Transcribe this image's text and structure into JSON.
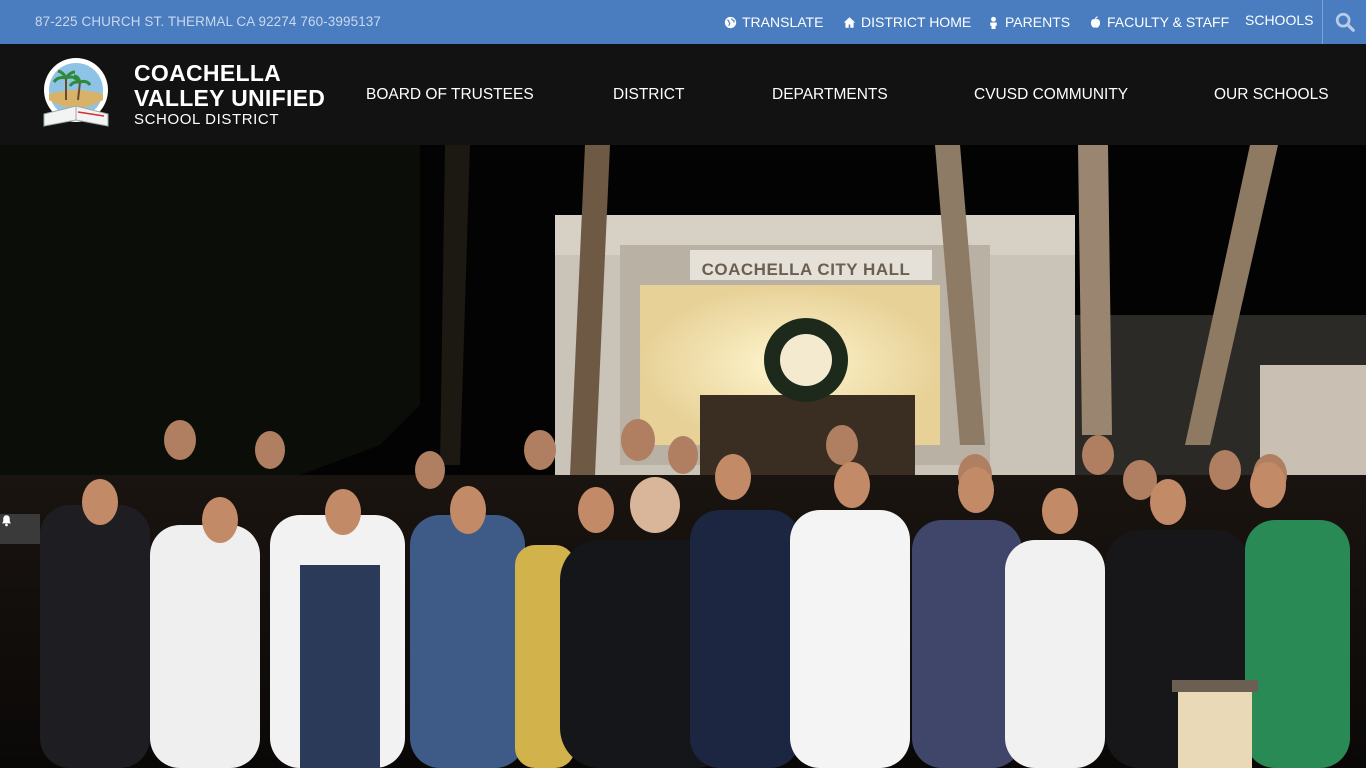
{
  "utility": {
    "address": "87-225 CHURCH ST. THERMAL CA 92274 760-3995137",
    "links": [
      {
        "label": "TRANSLATE",
        "icon": "globe-icon"
      },
      {
        "label": "DISTRICT HOME",
        "icon": "home-icon"
      },
      {
        "label": "PARENTS",
        "icon": "person-icon"
      },
      {
        "label": "FACULTY & STAFF",
        "icon": "apple-icon"
      },
      {
        "label": "SCHOOLS",
        "icon": ""
      }
    ],
    "search_icon": "search-icon",
    "bar_color": "#4a7cc0"
  },
  "brand": {
    "line1": "COACHELLA",
    "line2": "VALLEY UNIFIED",
    "line3": "SCHOOL DISTRICT"
  },
  "nav": {
    "items": [
      "BOARD OF TRUSTEES",
      "DISTRICT",
      "DEPARTMENTS",
      "CVUSD COMMUNITY",
      "OUR SCHOOLS"
    ],
    "bar_color": "#121212"
  },
  "hero": {
    "sign_text": "COACHELLA CITY HALL",
    "alert_icon": "bell-icon"
  }
}
